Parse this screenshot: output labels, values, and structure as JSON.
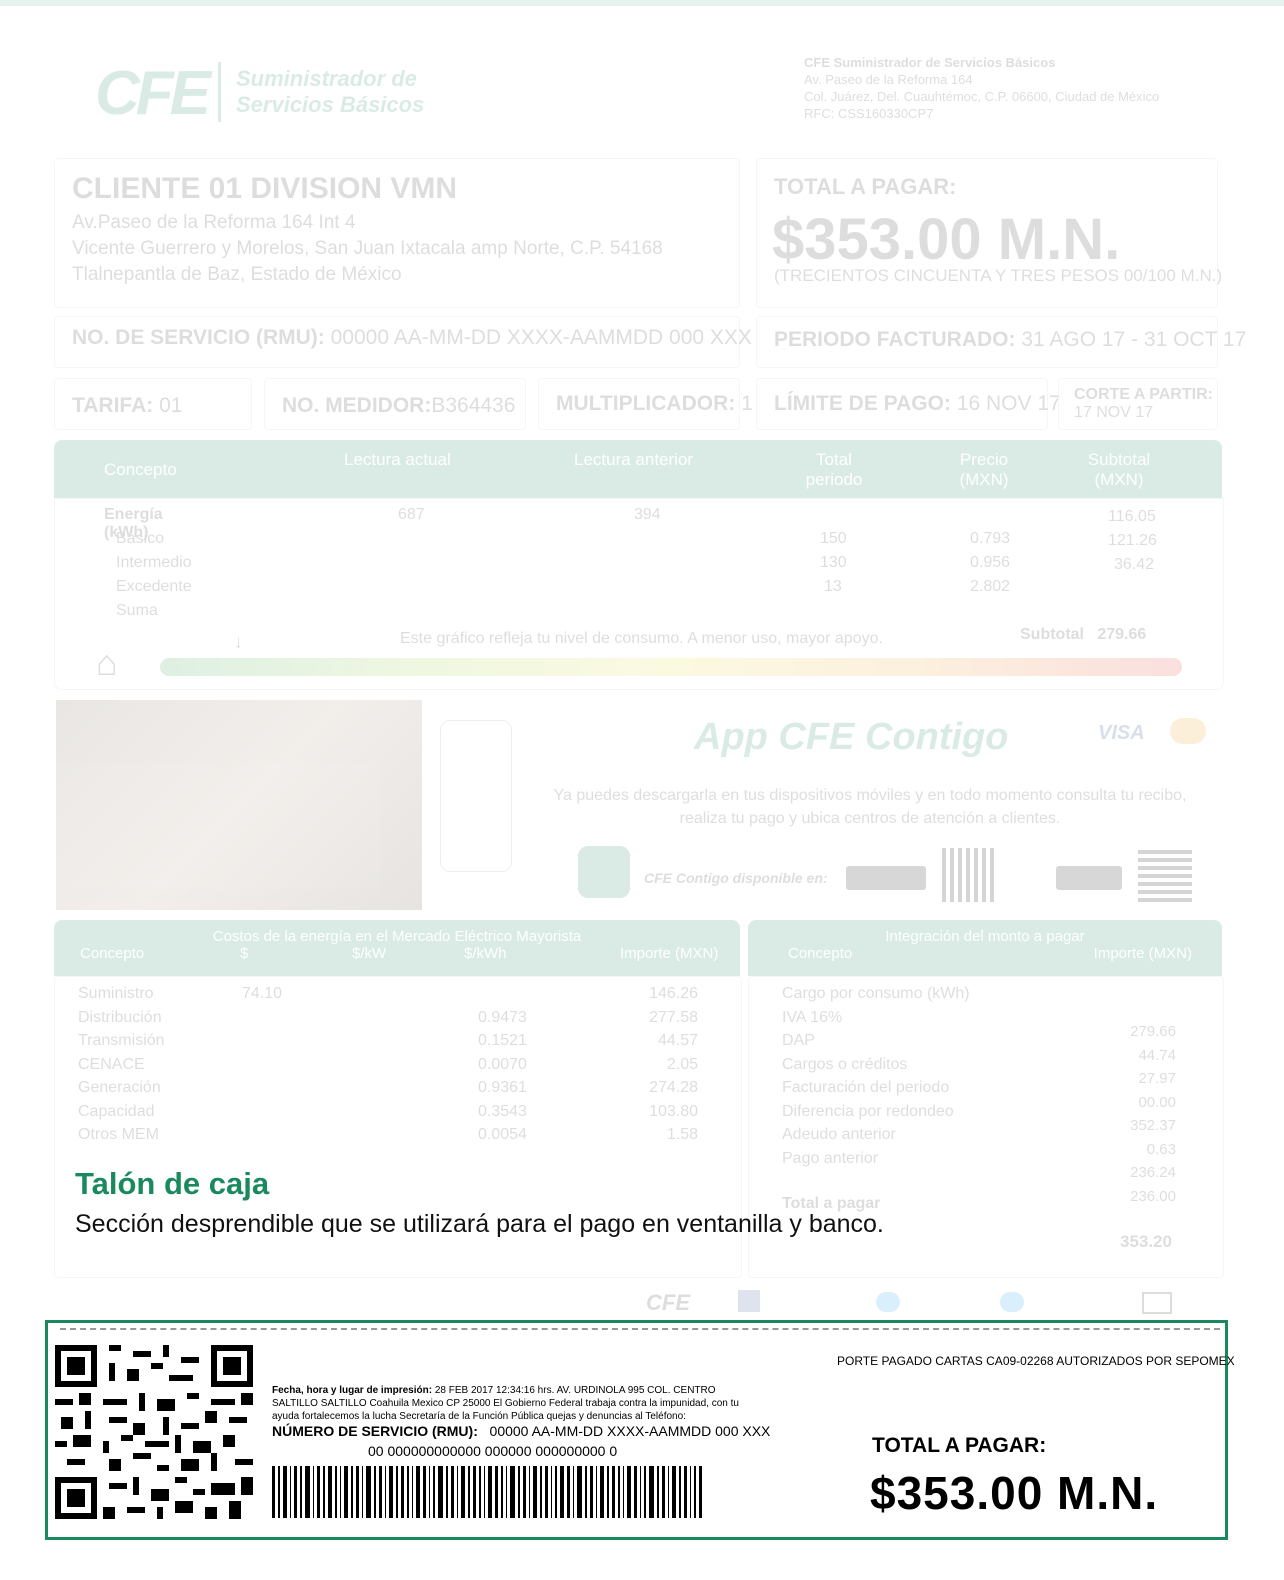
{
  "header": {
    "logo_text": "CFE",
    "logo_subtitle_line1": "Suministrador de",
    "logo_subtitle_line2": "Servicios Básicos",
    "issuer_name": "CFE Suministrador de Servicios Básicos",
    "issuer_address1": "Av. Paseo de la Reforma 164",
    "issuer_address2": "Col. Juárez, Del. Cuauhtémoc, C.P. 06600, Ciudad de México",
    "issuer_rfc": "RFC: CSS160330CP7"
  },
  "client": {
    "name": "CLIENTE 01 DIVISION VMN",
    "address1": "Av.Paseo de la Reforma 164 Int 4",
    "address2": "Vicente Guerrero y Morelos, San Juan Ixtacala amp Norte, C.P. 54168",
    "address3": "Tlalnepantla de Baz, Estado de México"
  },
  "summary": {
    "total_label": "TOTAL A PAGAR:",
    "total_amount": "$353.00 M.N.",
    "total_words": "(TRECIENTOS CINCUENTA Y TRES PESOS 00/100 M.N.)",
    "service_label": "NO. DE SERVICIO (RMU):",
    "service_value": "00000 AA-MM-DD XXXX-AAMMDD 000 XXX",
    "period_label": "PERIODO FACTURADO:",
    "period_value": "31 AGO 17 - 31 OCT 17",
    "tarifa_label": "TARIFA:",
    "tarifa_value": "01",
    "medidor_label": "NO. MEDIDOR:",
    "medidor_value": "B364436",
    "multiplicador_label": "MULTIPLICADOR:",
    "multiplicador_value": "1",
    "limite_label": "LÍMITE DE PAGO:",
    "limite_value": "16 NOV 17",
    "corte_label": "CORTE A PARTIR:",
    "corte_value": "17 NOV 17"
  },
  "consumption": {
    "headers": [
      "Concepto",
      "Lectura actual",
      "Lectura anterior",
      "Total periodo",
      "Precio (MXN)",
      "Subtotal (MXN)"
    ],
    "rows": [
      {
        "concepto": "Energía (kWh)",
        "actual": "687",
        "anterior": "394",
        "total": "",
        "precio": "",
        "subtotal": "116.05"
      },
      {
        "concepto": "Básico",
        "actual": "",
        "anterior": "",
        "total": "150",
        "precio": "0.793",
        "subtotal": "121.26"
      },
      {
        "concepto": "Intermedio",
        "actual": "",
        "anterior": "",
        "total": "130",
        "precio": "0.956",
        "subtotal": "36.42"
      },
      {
        "concepto": "Excedente",
        "actual": "",
        "anterior": "",
        "total": "13",
        "precio": "2.802",
        "subtotal": ""
      },
      {
        "concepto": "Suma",
        "actual": "",
        "anterior": "",
        "total": "",
        "precio": "",
        "subtotal": ""
      }
    ],
    "gauge_caption": "Este gráfico refleja tu nivel de consumo. A menor uso, mayor apoyo.",
    "subtotal_label": "Subtotal",
    "subtotal_value": "279.66"
  },
  "promo": {
    "title": "App CFE Contigo",
    "text": "Ya puedes descargarla en tus dispositivos móviles y en todo momento consulta tu recibo, realiza tu pago y ubica centros de atención a clientes.",
    "available_label": "CFE Contigo disponible en:",
    "visa": "VISA"
  },
  "cost_table": {
    "title": "Costos de la energía en el Mercado Eléctrico Mayorista",
    "headers": [
      "Concepto",
      "$",
      "$/kW",
      "$/kWh",
      "Importe (MXN)"
    ],
    "rows": [
      {
        "concepto": "Suministro",
        "a": "74.10",
        "b": "",
        "c": "",
        "importe": "146.26"
      },
      {
        "concepto": "Distribución",
        "a": "",
        "b": "",
        "c": "0.9473",
        "importe": "277.58"
      },
      {
        "concepto": "Transmisión",
        "a": "",
        "b": "",
        "c": "0.1521",
        "importe": "44.57"
      },
      {
        "concepto": "CENACE",
        "a": "",
        "b": "",
        "c": "0.0070",
        "importe": "2.05"
      },
      {
        "concepto": "Generación",
        "a": "",
        "b": "",
        "c": "0.9361",
        "importe": "274.28"
      },
      {
        "concepto": "Capacidad",
        "a": "",
        "b": "",
        "c": "0.3543",
        "importe": "103.80"
      },
      {
        "concepto": "Otros MEM",
        "a": "",
        "b": "",
        "c": "0.0054",
        "importe": "1.58"
      }
    ]
  },
  "payment_table": {
    "title": "Integración del monto a pagar",
    "headers": [
      "Concepto",
      "Importe (MXN)"
    ],
    "rows": [
      {
        "concepto": "Cargo por consumo (kWh)",
        "importe": ""
      },
      {
        "concepto": "IVA 16%",
        "importe": "279.66"
      },
      {
        "concepto": "DAP",
        "importe": "44.74"
      },
      {
        "concepto": "Cargos o créditos",
        "importe": "27.97"
      },
      {
        "concepto": "Facturación del periodo",
        "importe": "00.00"
      },
      {
        "concepto": "Diferencia por redondeo",
        "importe": "352.37"
      },
      {
        "concepto": "Adeudo anterior",
        "importe": "0.63"
      },
      {
        "concepto": "Pago anterior",
        "importe": "236.24"
      },
      {
        "concepto": "Total a pagar",
        "importe": "236.00"
      }
    ],
    "grand_total": "353.20"
  },
  "callout": {
    "title": "Talón de caja",
    "description": "Sección desprendible que se utilizará para el pago en ventanilla y banco."
  },
  "stub": {
    "porte": "PORTE PAGADO CARTAS CA09-02268  AUTORIZADOS POR SEPOMEX",
    "print_label": "Fecha, hora y lugar de impresión:",
    "print_text": "28 FEB 2017 12:34:16 hrs. AV. URDINOLA 995 COL. CENTRO SALTILLO SALTILLO Coahuila Mexico CP 25000 El Gobierno Federal trabaja contra la impunidad, con tu ayuda fortalecemos la lucha Secretaría de la Función Pública quejas y denuncias al Teléfono:",
    "service_label": "NÚMERO DE SERVICIO (RMU):",
    "service_value": "00000 AA-MM-DD XXXX-AAMMDD 000 XXX",
    "reference": "00 000000000000 000000 000000000 0",
    "total_label": "TOTAL A PAGAR:",
    "total_amount": "$353.00 M.N."
  },
  "colors": {
    "brand_green": "#1a8a5e",
    "stub_border": "#1a8a5e"
  }
}
